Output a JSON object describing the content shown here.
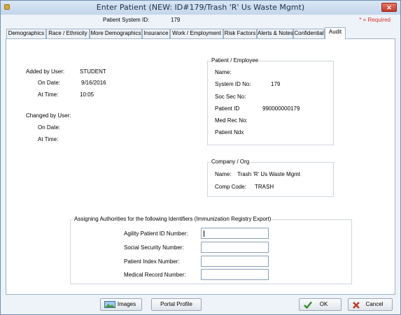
{
  "window": {
    "title": "Enter Patient (NEW: ID#179/Trash 'R' Us Waste Mgmt)",
    "close_glyph": "✕"
  },
  "info": {
    "system_id_label": "Patient System ID:",
    "system_id_value": "179",
    "required_note": "* = Required"
  },
  "tabs": [
    {
      "label": "Demographics"
    },
    {
      "label": "Race / Ethnicity"
    },
    {
      "label": "More Demographics"
    },
    {
      "label": "Insurance"
    },
    {
      "label": "Work / Employment"
    },
    {
      "label": "Risk Factors"
    },
    {
      "label": "Alerts & Notes"
    },
    {
      "label": "Confidential"
    },
    {
      "label": "Audit",
      "active": true
    }
  ],
  "audit": {
    "added_by_label": "Added by User:",
    "added_by_value": "STUDENT",
    "added_on_label": "On Date:",
    "added_on_value": "9/16/2016",
    "added_at_label": "At Time:",
    "added_at_value": "10:05",
    "changed_by_label": "Changed by User:",
    "changed_on_label": "On Date:",
    "changed_at_label": "At Time:"
  },
  "patient_group": {
    "legend": "Patient / Employee",
    "name_label": "Name:",
    "system_id_label": "System ID No:",
    "system_id_value": "179",
    "ssn_label": "Soc Sec No:",
    "patient_id_label": "Patient ID",
    "patient_id_value": "990000000179",
    "med_rec_label": "Med Rec No:",
    "ndx_label": "Patient Ndx"
  },
  "company_group": {
    "legend": "Company / Org",
    "name_label": "Name:",
    "name_value": "Trash 'R' Us Waste Mgmt",
    "code_label": "Comp Code:",
    "code_value": "TRASH"
  },
  "authorities": {
    "legend": "Assigning Authorities for the following Identifiers (Immunization Registry Export)",
    "fields": [
      {
        "label": "Agility Patient ID Number:",
        "value": ""
      },
      {
        "label": "Social Security Number:",
        "value": ""
      },
      {
        "label": "Patient Index Number:",
        "value": ""
      },
      {
        "label": "Medical Record Number:",
        "value": ""
      }
    ]
  },
  "buttons": {
    "images": "Images",
    "portal": "Portal Profile",
    "ok": "OK",
    "cancel": "Cancel"
  },
  "icons": {
    "ok": "checkmark-icon",
    "cancel": "x-icon",
    "images": "image-icon"
  }
}
